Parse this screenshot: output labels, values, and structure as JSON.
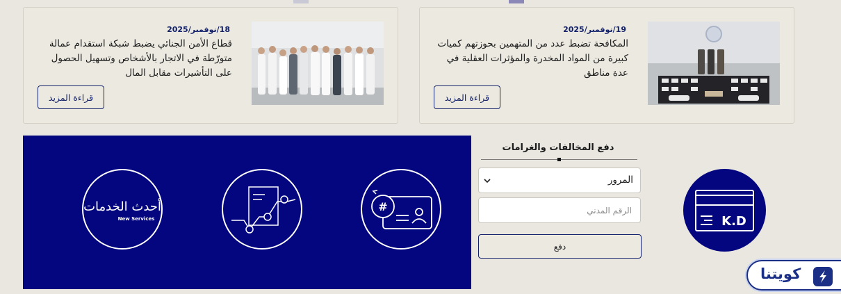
{
  "news": [
    {
      "date": "18/نوفمبر/2025",
      "title": "قطاع الأمن الجنائي يضبط شبكة استقدام عمالة متورّطة في الاتجار بالأشخاص وتسهيل الحصول على التأشيرات مقابل المال",
      "more_label": "قراءة المزيد",
      "image": "group-of-arrested-men-photo"
    },
    {
      "date": "19/نوفمبر/2025",
      "title": "المكافحة تضبط عدد من المتهمين بحوزتهم كميات كبيرة من المواد المخدرة والمؤثرات العقلية في عدة مناطق",
      "more_label": "قراءة المزيد",
      "image": "seized-drugs-display-photo"
    }
  ],
  "services": [
    {
      "name": "new-services",
      "icon": "new-services-logo-icon",
      "label_ar": "أحدث الخدمات",
      "label_en": "New Services"
    },
    {
      "name": "document-tracking",
      "icon": "document-tracking-icon"
    },
    {
      "name": "civil-id-card",
      "icon": "civil-id-card-icon"
    }
  ],
  "payment": {
    "title": "دفع المخالفات والغرامات",
    "category_value": "المرور",
    "civil_id_placeholder": "الرقم المدني",
    "pay_label": "دفع",
    "kd_label": "K.D"
  },
  "badge": {
    "label": "كويتنا"
  },
  "colors": {
    "navy": "#03067f",
    "accent": "#13226b",
    "background": "#eae7e0"
  }
}
